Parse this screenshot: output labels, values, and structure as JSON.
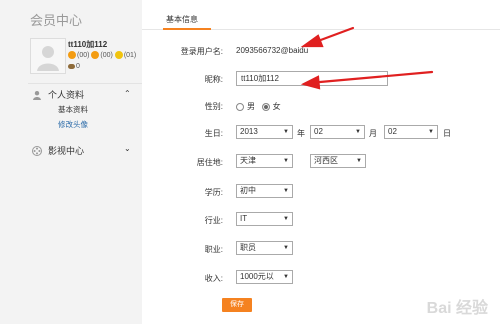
{
  "sidebar": {
    "title": "会员中心",
    "username": "tt110加112",
    "badges": [
      {
        "color": "orange",
        "count": "(00)"
      },
      {
        "color": "orange",
        "count": "(00)"
      },
      {
        "color": "yellow",
        "count": "(01)"
      }
    ],
    "coins": "0",
    "sections": [
      {
        "label": "个人资料",
        "icon": "user-icon",
        "sub": [
          "基本资料",
          "修改头像"
        ]
      },
      {
        "label": "影视中心",
        "icon": "film-icon"
      }
    ]
  },
  "main": {
    "tab": "基本信息",
    "login_label": "登录用户名:",
    "login_value": "2093566732@baidu",
    "nickname_label": "昵称:",
    "nickname_value": "tt110加112",
    "gender_label": "性别:",
    "gender_options": [
      "男",
      "女"
    ],
    "gender_selected": "女",
    "birthday_label": "生日:",
    "birthday": {
      "year": "2013",
      "month": "02",
      "day": "02",
      "year_unit": "年",
      "month_unit": "月",
      "day_unit": "日"
    },
    "residence_label": "居住地:",
    "residence": {
      "city": "天津",
      "district": "河西区"
    },
    "education_label": "学历:",
    "education": "初中",
    "industry_label": "行业:",
    "industry": "IT",
    "job_label": "职业:",
    "job": "职员",
    "income_label": "收入:",
    "income": "1000元以",
    "save_label": "保存"
  },
  "watermark": "Bai 经验",
  "colors": {
    "accent": "#f58220",
    "link": "#2a6aa8",
    "arrow": "#e02020"
  }
}
